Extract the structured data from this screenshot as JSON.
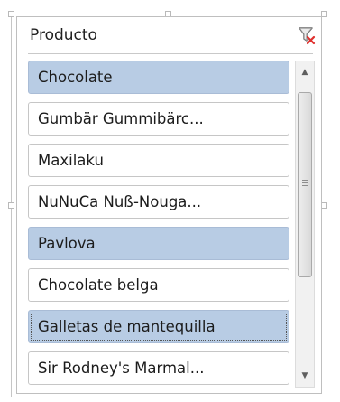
{
  "slicer": {
    "title": "Producto",
    "clear_filter_icon": "filter-clear-icon",
    "items": [
      {
        "label": "Chocolate",
        "selected": true
      },
      {
        "label": "Gumbär Gummibärc...",
        "selected": false
      },
      {
        "label": "Maxilaku",
        "selected": false
      },
      {
        "label": "NuNuCa Nuß-Nouga...",
        "selected": false
      },
      {
        "label": "Pavlova",
        "selected": true
      },
      {
        "label": "Chocolate belga",
        "selected": false
      },
      {
        "label": "Galletas de mantequilla",
        "selected": true,
        "focused": true
      },
      {
        "label": "Sir Rodney's Marmal...",
        "selected": false
      }
    ],
    "colors": {
      "selected_fill": "#b8cce4",
      "item_border": "#c6c6c6",
      "filter_clear_red": "#e0312f"
    }
  }
}
